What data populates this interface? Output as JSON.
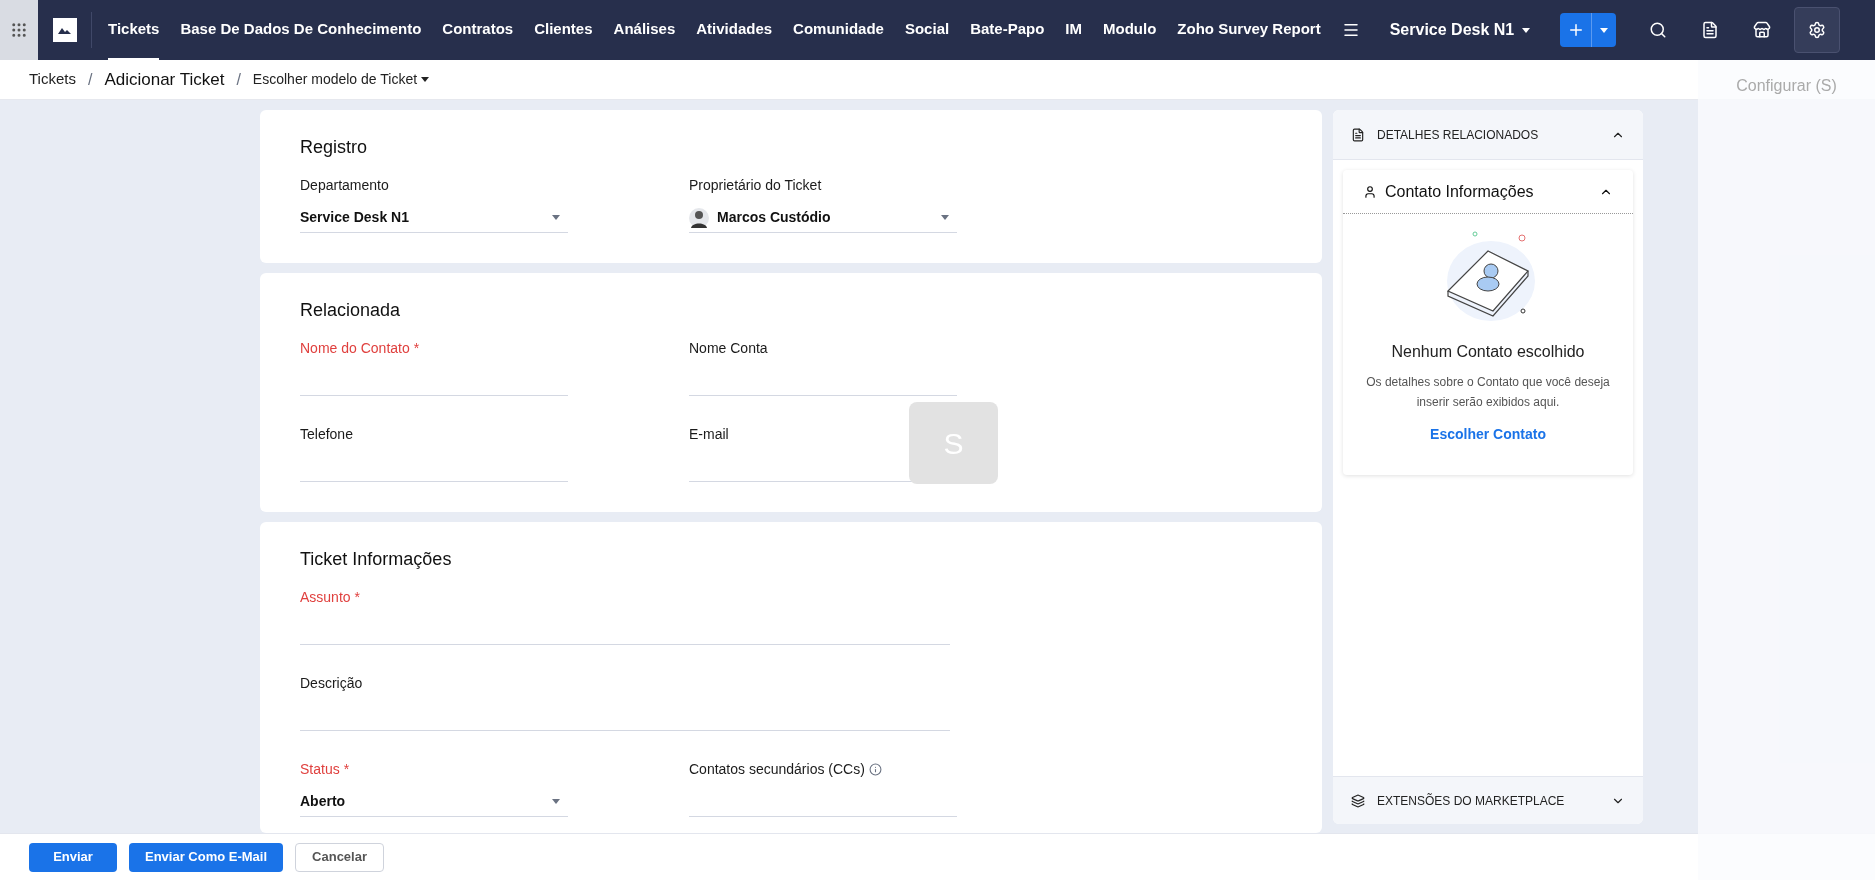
{
  "nav": {
    "tabs": [
      {
        "label": "Tickets",
        "selected": true
      },
      {
        "label": "Base De Dados De Conhecimento",
        "selected": false
      },
      {
        "label": "Contratos",
        "selected": false
      },
      {
        "label": "Clientes",
        "selected": false
      },
      {
        "label": "Análises",
        "selected": false
      },
      {
        "label": "Atividades",
        "selected": false
      },
      {
        "label": "Comunidade",
        "selected": false
      },
      {
        "label": "Social",
        "selected": false
      },
      {
        "label": "Bate-Papo",
        "selected": false
      },
      {
        "label": "IM",
        "selected": false
      },
      {
        "label": "Modulo",
        "selected": false
      },
      {
        "label": "Zoho Survey Report",
        "selected": false
      }
    ],
    "department": "Service Desk N1"
  },
  "breadcrumb": {
    "separators": [
      "/",
      "/"
    ],
    "root": "Tickets",
    "current": "Adicionar Ticket",
    "template": "Escolher modelo de Ticket"
  },
  "tooltip": "Configurar (S)",
  "overlay_letter": "S",
  "sections": [
    {
      "title": "Registro",
      "fields": [
        {
          "label": "Departamento",
          "required": false,
          "kind": "select",
          "value": "Service Desk N1",
          "wide": false
        },
        {
          "label": "Proprietário do Ticket",
          "required": false,
          "kind": "user",
          "value": "Marcos Custódio",
          "wide": false
        }
      ]
    },
    {
      "title": "Relacionada",
      "fields": [
        {
          "label": "Nome do Contato",
          "required": true,
          "mark": "*",
          "kind": "text",
          "wide": false
        },
        {
          "label": "Nome Conta",
          "required": false,
          "kind": "text",
          "wide": false
        },
        {
          "label": "Telefone",
          "required": false,
          "kind": "text",
          "wide": false
        },
        {
          "label": "E-mail",
          "required": false,
          "kind": "text",
          "wide": false
        }
      ]
    },
    {
      "title": "Ticket Informações",
      "fields": [
        {
          "label": "Assunto",
          "required": true,
          "mark": "*",
          "kind": "text",
          "wide": true
        },
        {
          "label": "Descrição",
          "required": false,
          "kind": "text",
          "wide": true
        },
        {
          "label": "Status",
          "required": true,
          "mark": "*",
          "kind": "select",
          "value": "Aberto",
          "wide": false
        },
        {
          "label": "Contatos secundários (CCs)",
          "required": false,
          "kind": "text",
          "wide": false,
          "info": true
        }
      ]
    }
  ],
  "side": {
    "header": "DETALHES RELACIONADOS",
    "expanded": true,
    "contact": {
      "title": "Contato Informações",
      "expanded": true,
      "empty_title": "Nenhum Contato escolhido",
      "empty_text": "Os detalhes sobre o Contato que você deseja inserir serão exibidos aqui.",
      "link": "Escolher Contato"
    },
    "footer": {
      "label": "EXTENSÕES DO MARKETPLACE",
      "expanded": false
    }
  },
  "actions": [
    {
      "label": "Enviar",
      "kind": "primary"
    },
    {
      "label": "Enviar Como E-Mail",
      "kind": "primary"
    },
    {
      "label": "Cancelar",
      "kind": "secondary"
    }
  ]
}
